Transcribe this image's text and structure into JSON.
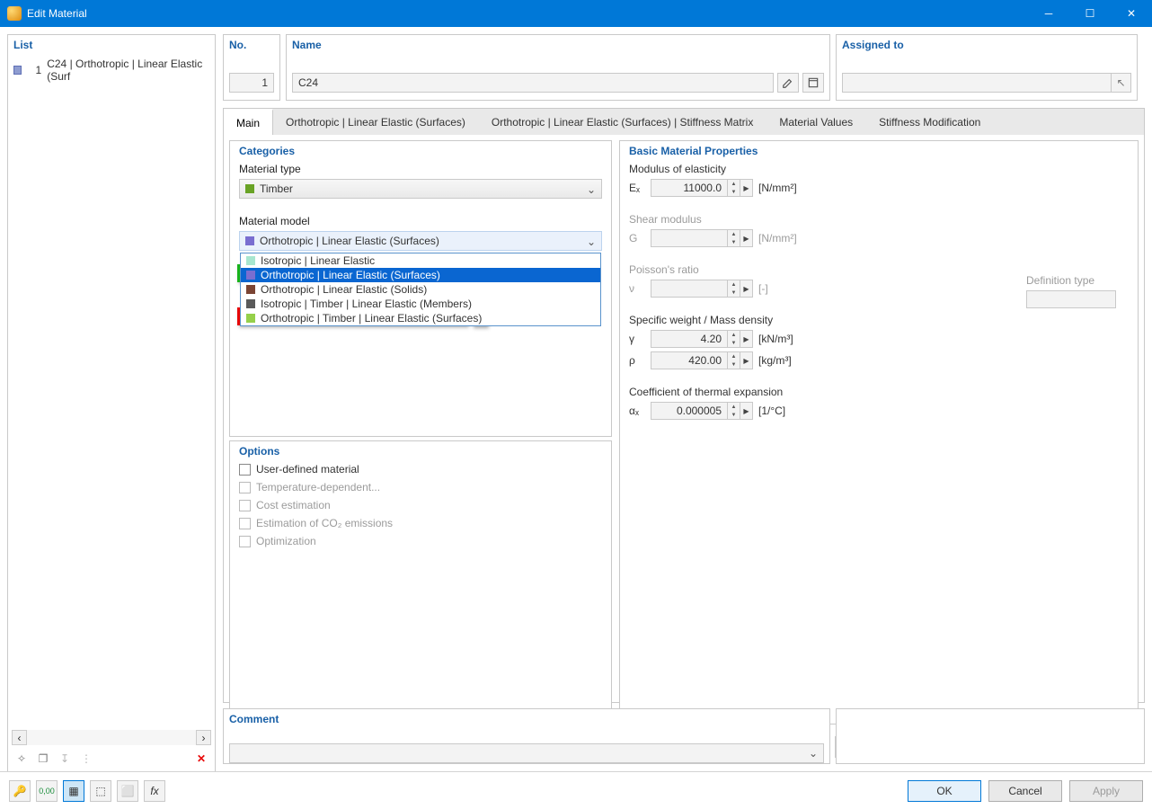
{
  "window": {
    "title": "Edit Material"
  },
  "left": {
    "header": "List",
    "item_no": "1",
    "item_label": "C24 | Orthotropic | Linear Elastic (Surf"
  },
  "top": {
    "no_label": "No.",
    "no_value": "1",
    "name_label": "Name",
    "name_value": "C24",
    "assigned_label": "Assigned to"
  },
  "tabs": [
    "Main",
    "Orthotropic | Linear Elastic (Surfaces)",
    "Orthotropic | Linear Elastic (Surfaces) | Stiffness Matrix",
    "Material Values",
    "Stiffness Modification"
  ],
  "categories": {
    "header": "Categories",
    "type_label": "Material type",
    "type_value": "Timber",
    "model_label": "Material model",
    "model_value": "Orthotropic | Linear Elastic (Surfaces)",
    "dropdown": [
      {
        "label": "Isotropic | Linear Elastic",
        "color": "#a8e6cf"
      },
      {
        "label": "Orthotropic | Linear Elastic (Surfaces)",
        "color": "#7a6ed0",
        "sel": true
      },
      {
        "label": "Orthotropic | Linear Elastic (Solids)",
        "color": "#7a4434"
      },
      {
        "label": "Isotropic | Timber | Linear Elastic (Members)",
        "color": "#5a5a5a"
      },
      {
        "label": "Orthotropic | Timber | Linear Elastic (Surfaces)",
        "color": "#95d04a"
      }
    ]
  },
  "options": {
    "header": "Options",
    "items": [
      {
        "label": "User-defined material",
        "dis": false
      },
      {
        "label": "Temperature-dependent...",
        "dis": true
      },
      {
        "label": "Cost estimation",
        "dis": true
      },
      {
        "label": "Estimation of CO₂ emissions",
        "dis": true
      },
      {
        "label": "Optimization",
        "dis": true
      }
    ]
  },
  "basic": {
    "header": "Basic Material Properties",
    "modulus_label": "Modulus of elasticity",
    "shear_label": "Shear modulus",
    "def_label": "Definition type",
    "poisson_label": "Poisson's ratio",
    "weight_label": "Specific weight / Mass density",
    "thermal_label": "Coefficient of thermal expansion",
    "rows": {
      "E": {
        "sym": "Eₓ",
        "val": "11000.0",
        "unit": "[N/mm²]"
      },
      "G": {
        "sym": "G",
        "val": "",
        "unit": "[N/mm²]"
      },
      "v": {
        "sym": "ν",
        "val": "",
        "unit": "[-]"
      },
      "gamma": {
        "sym": "γ",
        "val": "4.20",
        "unit": "[kN/m³]"
      },
      "rho": {
        "sym": "ρ",
        "val": "420.00",
        "unit": "[kg/m³]"
      },
      "alpha": {
        "sym": "αₓ",
        "val": "0.000005",
        "unit": "[1/°C]"
      }
    }
  },
  "comment": {
    "header": "Comment"
  },
  "footer": {
    "ok": "OK",
    "cancel": "Cancel",
    "apply": "Apply"
  }
}
